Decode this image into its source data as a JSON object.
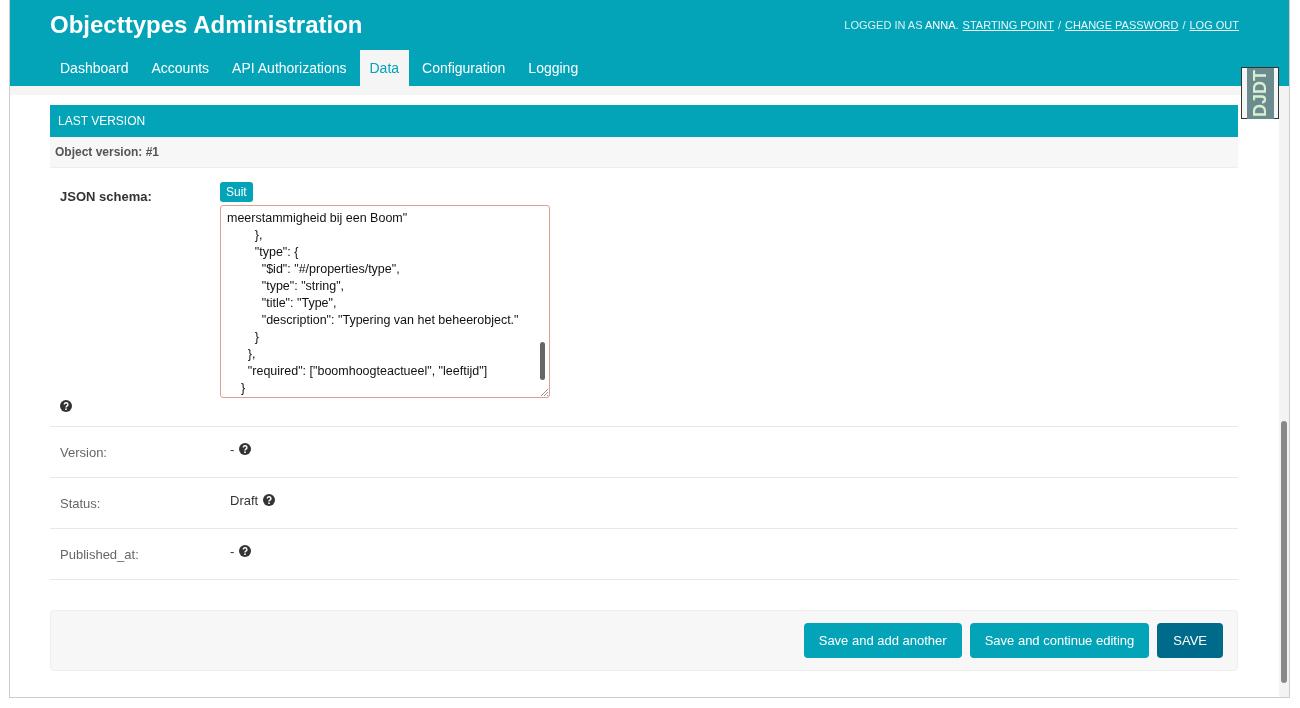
{
  "header": {
    "title": "Objecttypes Administration",
    "user_prefix": "LOGGED IN AS ",
    "user": "ANNA",
    "user_suffix": ".",
    "links": [
      "STARTING POINT",
      "CHANGE PASSWORD",
      "LOG OUT"
    ],
    "separator": "/"
  },
  "nav": [
    {
      "label": "Dashboard",
      "selected": false
    },
    {
      "label": "Accounts",
      "selected": false
    },
    {
      "label": "API Authorizations",
      "selected": false
    },
    {
      "label": "Data",
      "selected": true
    },
    {
      "label": "Configuration",
      "selected": false
    },
    {
      "label": "Logging",
      "selected": false
    }
  ],
  "toolbar_badge": "DJDT",
  "section": {
    "title": "LAST VERSION",
    "subtitle": "Object version: #1"
  },
  "json_field": {
    "label": "JSON schema:",
    "button": "Suit",
    "lines": [
      "meerstammigheid bij een Boom\"",
      "        },",
      "        \"type\": {",
      "          \"$id\": \"#/properties/type\",",
      "          \"type\": \"string\",",
      "          \"title\": \"Type\",",
      "          \"description\": \"Typering van het beheerobject.\"",
      "        }",
      "      },",
      "      \"required\": [\"boomhoogteactueel\", \"leeftijd\"]",
      "    }"
    ]
  },
  "fields": [
    {
      "label": "Version:",
      "value": "-"
    },
    {
      "label": "Status:",
      "value": "Draft"
    },
    {
      "label": "Published_at:",
      "value": "-"
    }
  ],
  "buttons": [
    {
      "label": "Save and add another",
      "kind": "secondary"
    },
    {
      "label": "Save and continue editing",
      "kind": "secondary"
    },
    {
      "label": "SAVE",
      "kind": "primary"
    }
  ]
}
